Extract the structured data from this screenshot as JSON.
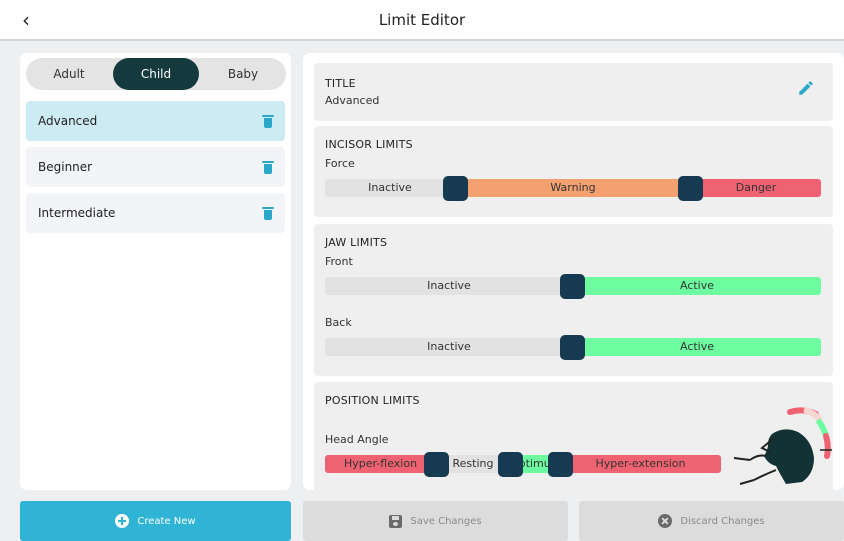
{
  "header": {
    "back_glyph": "‹",
    "title": "Limit Editor"
  },
  "profile_tabs": [
    {
      "label": "Adult",
      "active": false
    },
    {
      "label": "Child",
      "active": true
    },
    {
      "label": "Baby",
      "active": false
    }
  ],
  "limits_list": [
    {
      "label": "Advanced",
      "selected": true,
      "icon": "trash-icon"
    },
    {
      "label": "Beginner",
      "selected": false,
      "icon": "trash-icon"
    },
    {
      "label": "Intermediate",
      "selected": false,
      "icon": "trash-icon"
    }
  ],
  "title_card": {
    "heading": "TITLE",
    "value": "Advanced",
    "icon": "pencil-icon"
  },
  "incisor": {
    "heading": "INCISOR LIMITS",
    "force": {
      "label": "Force",
      "segments": [
        "Inactive",
        "Warning",
        "Danger"
      ]
    }
  },
  "jaw": {
    "heading": "JAW LIMITS",
    "front": {
      "label": "Front",
      "segments": [
        "Inactive",
        "Active"
      ]
    },
    "back": {
      "label": "Back",
      "segments": [
        "Inactive",
        "Active"
      ]
    }
  },
  "position": {
    "heading": "POSITION LIMITS",
    "head_angle": {
      "label": "Head Angle",
      "segments": [
        "Hyper-flexion",
        "Resting",
        "Optimum",
        "Hyper-extension"
      ]
    }
  },
  "actions": {
    "create": {
      "label": "Create New",
      "icon": "plus-circle-icon"
    },
    "save": {
      "label": "Save Changes",
      "icon": "floppy-disk-icon"
    },
    "discard": {
      "label": "Discard Changes",
      "icon": "x-circle-icon"
    }
  },
  "colors": {
    "accent": "#2aa8c8",
    "dark_teal": "#143a3d",
    "handle": "#163a52",
    "inactive": "#e2e2e2",
    "warning": "#f4a070",
    "danger": "#ef6272",
    "active": "#6dfca0"
  }
}
